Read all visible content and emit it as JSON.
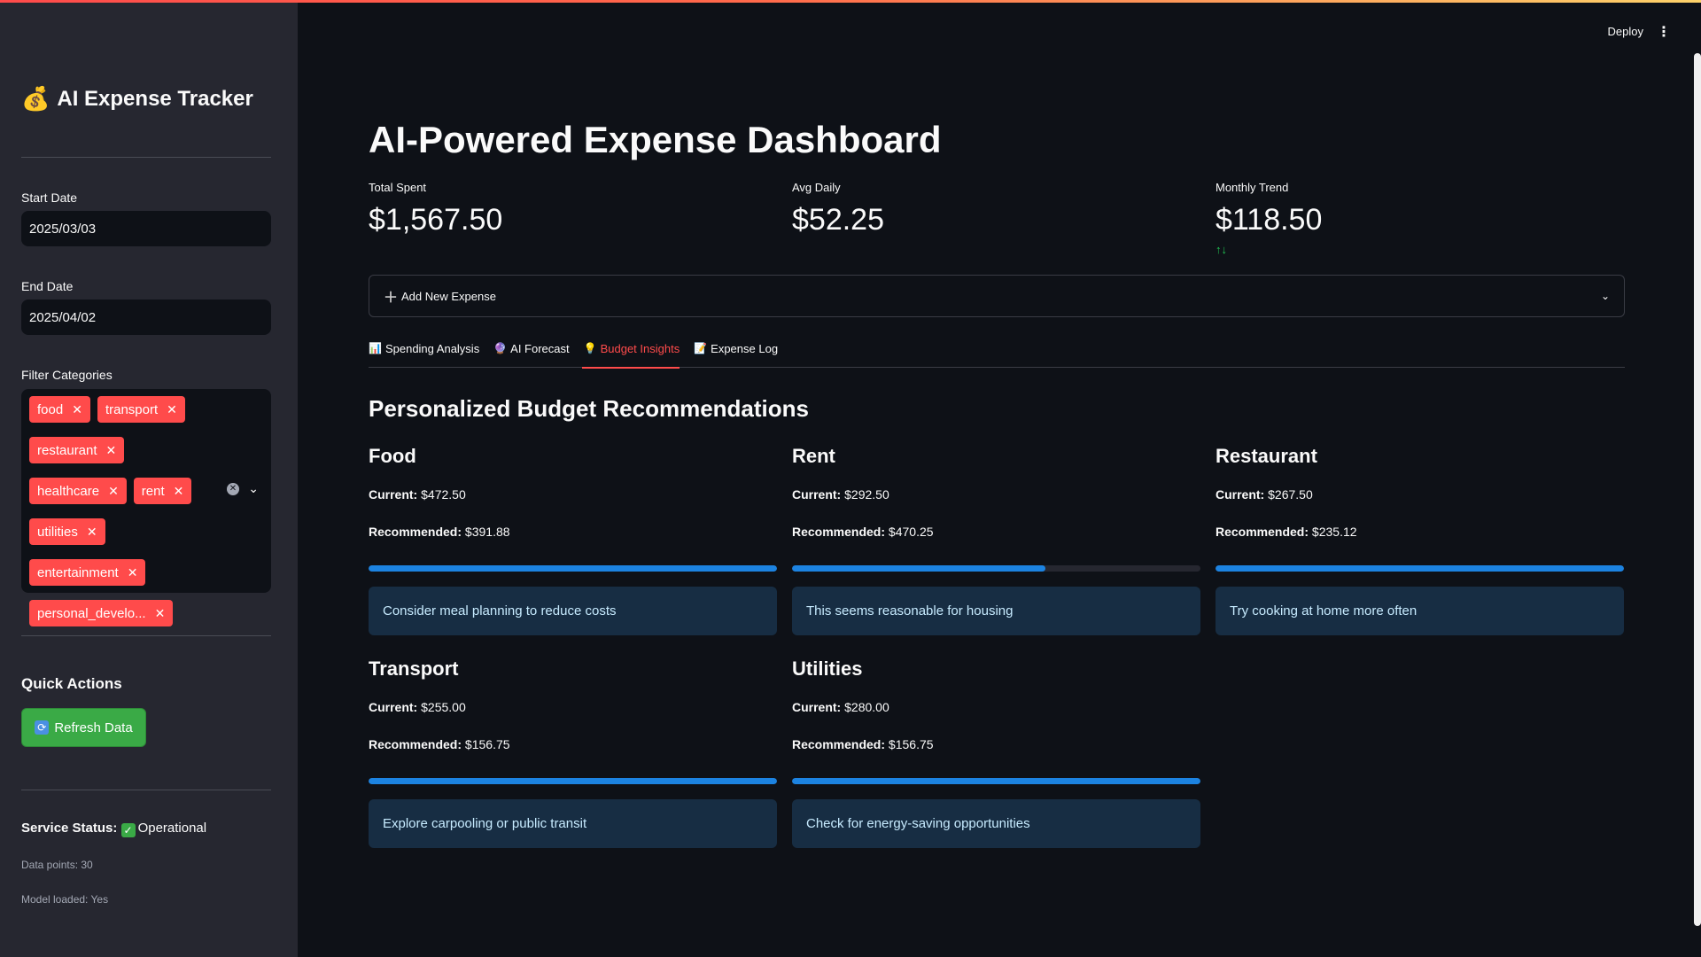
{
  "sidebar": {
    "app_title": "AI Expense Tracker",
    "app_emoji": "💰",
    "start_date_label": "Start Date",
    "start_date_value": "2025/03/03",
    "end_date_label": "End Date",
    "end_date_value": "2025/04/02",
    "filter_label": "Filter Categories",
    "categories": [
      "food",
      "transport",
      "restaurant",
      "healthcare",
      "rent",
      "utilities",
      "entertainment",
      "personal_develo..."
    ],
    "quick_actions_title": "Quick Actions",
    "refresh_label": "Refresh Data",
    "service_status_label": "Service Status:",
    "service_status_value": "Operational",
    "data_points": "Data points: 30",
    "model_loaded": "Model loaded: Yes"
  },
  "header": {
    "deploy_label": "Deploy"
  },
  "main": {
    "title": "AI-Powered Expense Dashboard",
    "metrics": [
      {
        "label": "Total Spent",
        "value": "$1,567.50"
      },
      {
        "label": "Avg Daily",
        "value": "$52.25"
      },
      {
        "label": "Monthly Trend",
        "value": "$118.50"
      }
    ],
    "expander_label": "Add New Expense",
    "tabs": [
      {
        "icon": "📊",
        "label": "Spending Analysis",
        "active": false
      },
      {
        "icon": "🔮",
        "label": "AI Forecast",
        "active": false
      },
      {
        "icon": "💡",
        "label": "Budget Insights",
        "active": true
      },
      {
        "icon": "📝",
        "label": "Expense Log",
        "active": false
      }
    ],
    "section_title": "Personalized Budget Recommendations",
    "current_prefix": "Current:",
    "recommended_prefix": "Recommended:",
    "recommendations": [
      {
        "category": "Food",
        "current": "$472.50",
        "recommended": "$391.88",
        "progress": 1.0,
        "note": "Consider meal planning to reduce costs"
      },
      {
        "category": "Rent",
        "current": "$292.50",
        "recommended": "$470.25",
        "progress": 0.62,
        "note": "This seems reasonable for housing"
      },
      {
        "category": "Restaurant",
        "current": "$267.50",
        "recommended": "$235.12",
        "progress": 1.0,
        "note": "Try cooking at home more often"
      },
      {
        "category": "Transport",
        "current": "$255.00",
        "recommended": "$156.75",
        "progress": 1.0,
        "note": "Explore carpooling or public transit"
      },
      {
        "category": "Utilities",
        "current": "$280.00",
        "recommended": "$156.75",
        "progress": 1.0,
        "note": "Check for energy-saving opportunities"
      }
    ]
  },
  "colors": {
    "accent": "#ff4b4b",
    "progress": "#1c83e1",
    "success": "#3aaa46",
    "info_bg": "#172d43"
  }
}
